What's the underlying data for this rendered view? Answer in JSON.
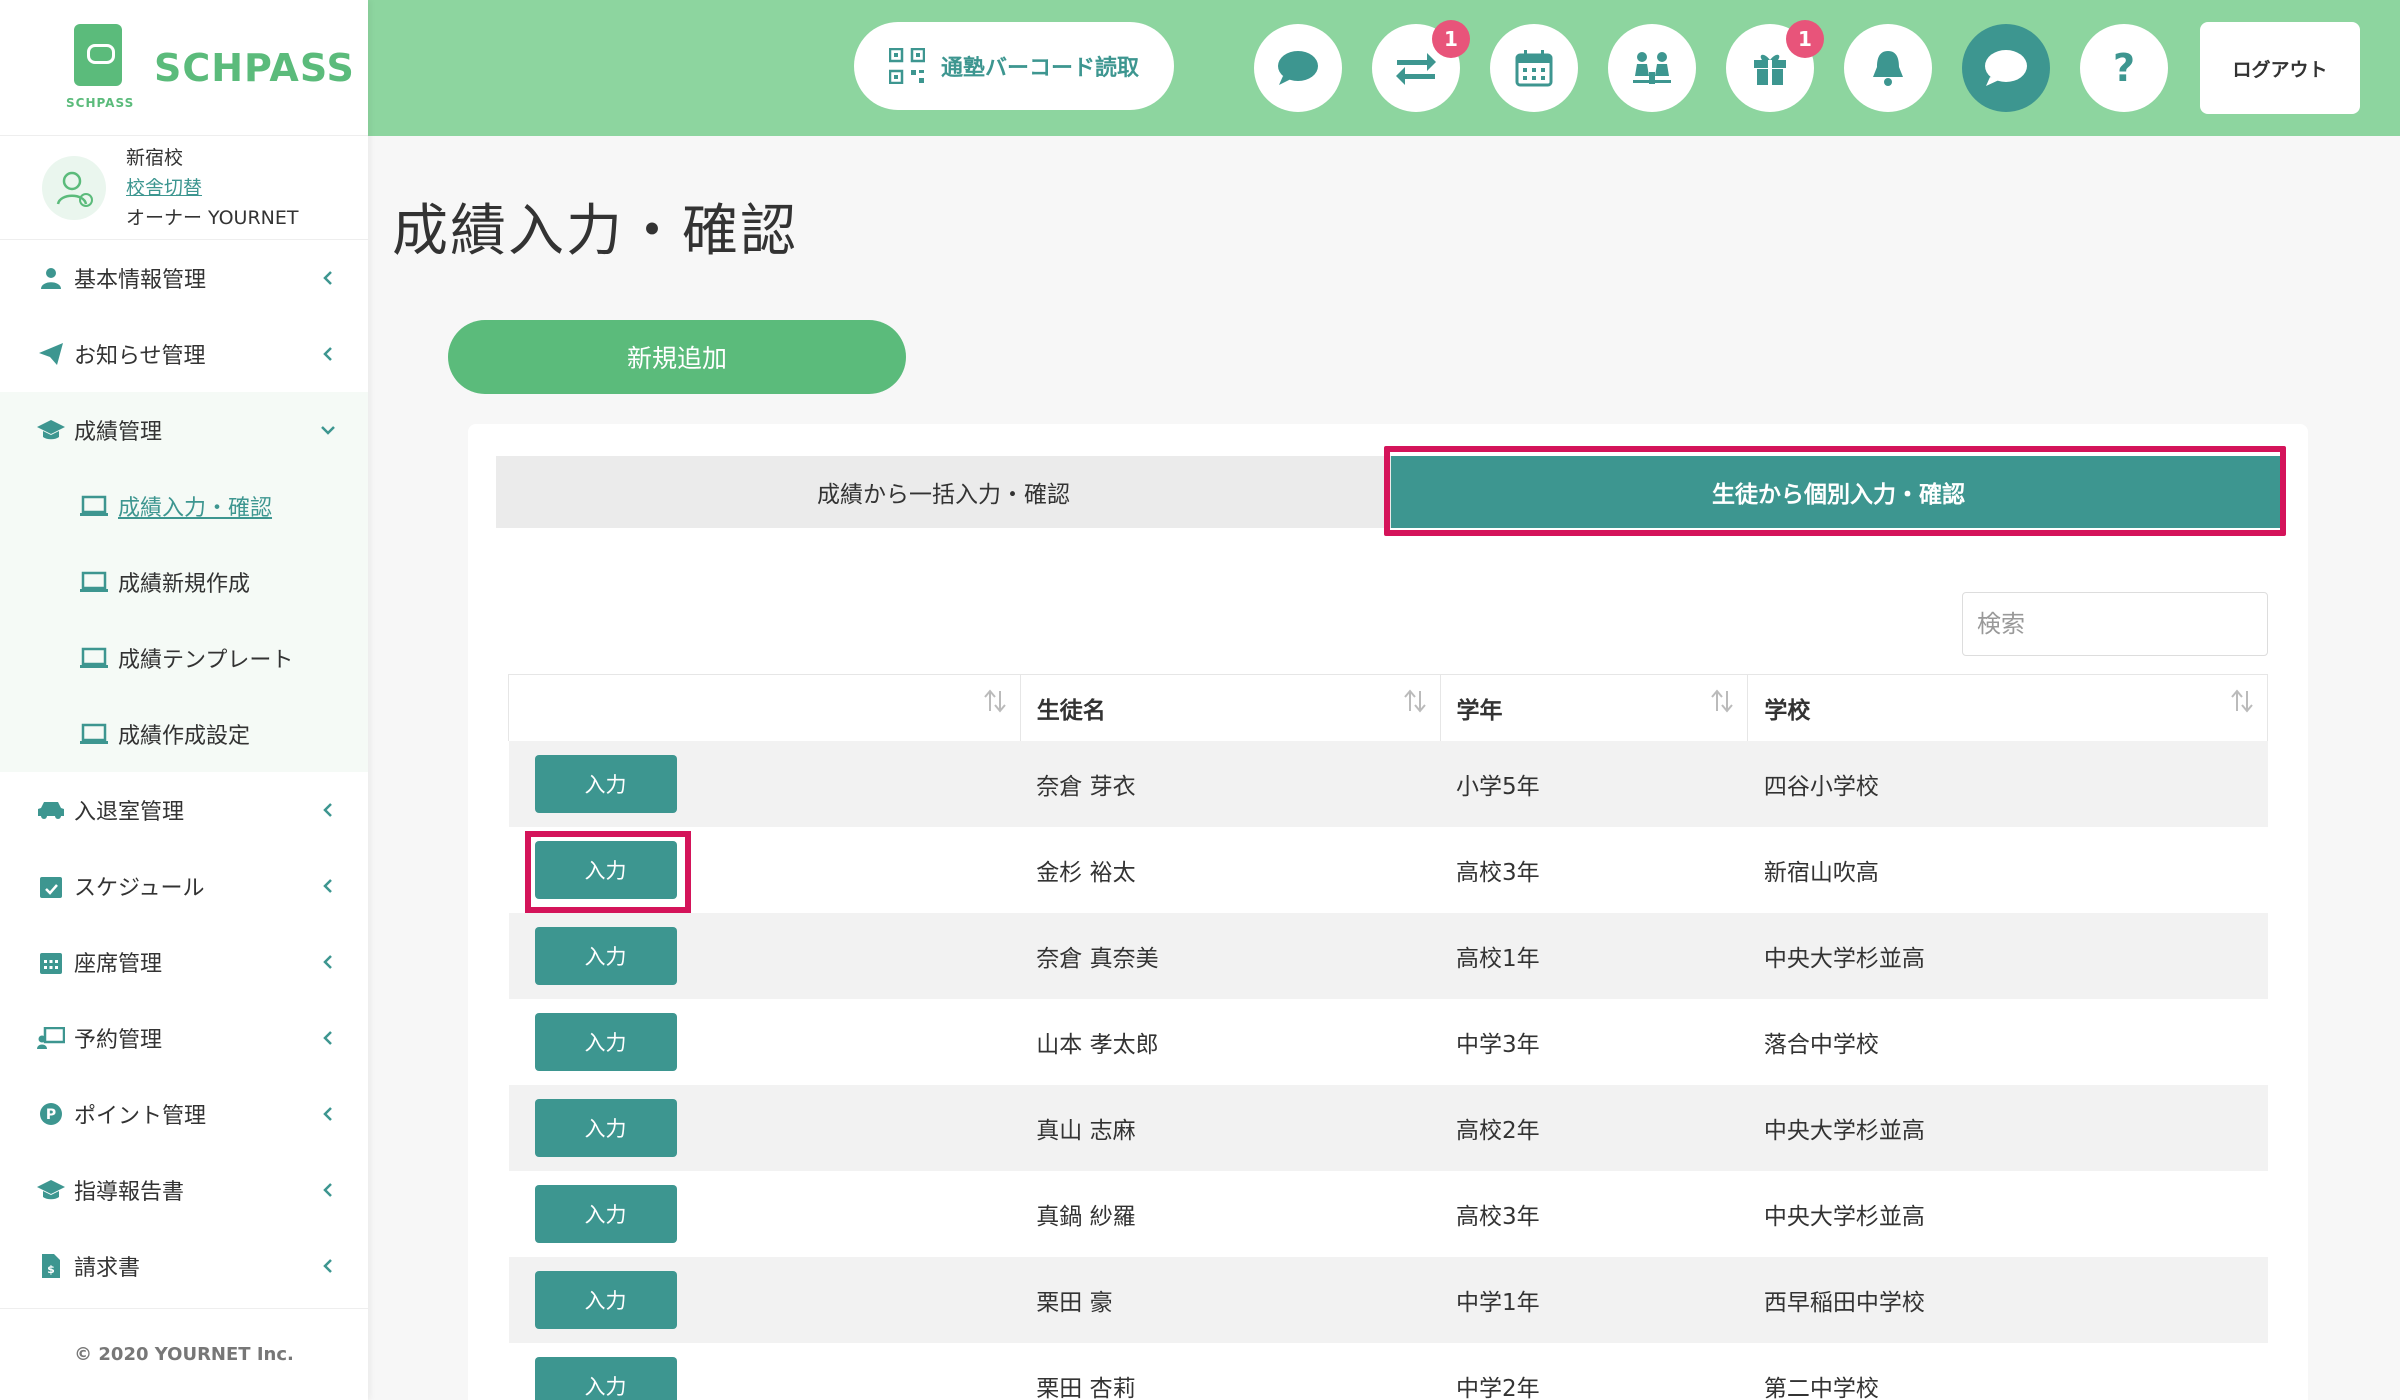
{
  "brand": {
    "name": "SCHPASS",
    "caption": "SCHPASS"
  },
  "school": {
    "name": "新宿校",
    "switch_label": "校舎切替",
    "owner": "オーナー YOURNET"
  },
  "sidebar": {
    "items": [
      {
        "label": "基本情報管理",
        "icon": "user-icon"
      },
      {
        "label": "お知らせ管理",
        "icon": "paper-plane-icon"
      },
      {
        "label": "成績管理",
        "icon": "graduation-cap-icon"
      },
      {
        "label": "入退室管理",
        "icon": "car-icon"
      },
      {
        "label": "スケジュール",
        "icon": "calendar-check-icon"
      },
      {
        "label": "座席管理",
        "icon": "calendar-grid-icon"
      },
      {
        "label": "予約管理",
        "icon": "teacher-board-icon"
      },
      {
        "label": "ポイント管理",
        "icon": "point-icon"
      },
      {
        "label": "指導報告書",
        "icon": "graduation-cap-icon"
      },
      {
        "label": "請求書",
        "icon": "invoice-icon"
      }
    ],
    "sub_items": [
      {
        "label": "成績入力・確認"
      },
      {
        "label": "成績新規作成"
      },
      {
        "label": "成績テンプレート"
      },
      {
        "label": "成績作成設定"
      }
    ],
    "footer": "© 2020 YOURNET Inc."
  },
  "header": {
    "barcode_label": "通塾バーコード読取",
    "badges": {
      "transfer": "1",
      "gift": "1"
    },
    "help": "?",
    "logout": "ログアウト"
  },
  "main": {
    "title": "成績入力・確認",
    "add_button": "新規追加",
    "tabs": [
      {
        "label": "成績から一括入力・確認"
      },
      {
        "label": "生徒から個別入力・確認"
      }
    ],
    "search_placeholder": "検索",
    "columns": [
      "",
      "生徒名",
      "学年",
      "学校"
    ],
    "row_button": "入力",
    "rows": [
      {
        "name": "奈倉 芽衣",
        "grade": "小学5年",
        "school": "四谷小学校"
      },
      {
        "name": "金杉 裕太",
        "grade": "高校3年",
        "school": "新宿山吹高"
      },
      {
        "name": "奈倉 真奈美",
        "grade": "高校1年",
        "school": "中央大学杉並高"
      },
      {
        "name": "山本 孝太郎",
        "grade": "中学3年",
        "school": "落合中学校"
      },
      {
        "name": "真山 志麻",
        "grade": "高校2年",
        "school": "中央大学杉並高"
      },
      {
        "name": "真鍋 紗羅",
        "grade": "高校3年",
        "school": "中央大学杉並高"
      },
      {
        "name": "栗田 豪",
        "grade": "中学1年",
        "school": "西早稲田中学校"
      },
      {
        "name": "栗田 杏莉",
        "grade": "中学2年",
        "school": "第二中学校"
      }
    ]
  },
  "colors": {
    "accent": "#3d9690",
    "brand_green": "#5bbb7b",
    "header_bg": "#8dd59f",
    "highlight": "#d4145a",
    "badge": "#e8547a"
  }
}
